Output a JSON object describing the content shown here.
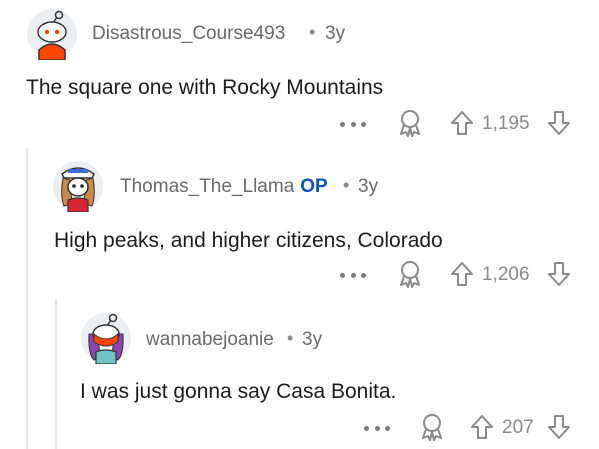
{
  "comments": [
    {
      "username": "Disastrous_Course493",
      "age": "3y",
      "separator": "•",
      "body": "The square one with Rocky Mountains",
      "score": "1,195",
      "avatar_icon": "snoo-avatar-icon"
    },
    {
      "username": "Thomas_The_Llama",
      "op_badge": "OP",
      "age": "3y",
      "separator": "•",
      "body": "High peaks, and higher citizens,  Colorado",
      "score": "1,206",
      "avatar_icon": "snoo-avatar-icon"
    },
    {
      "username": "wannabejoanie",
      "age": "3y",
      "separator": "•",
      "body": "I was just gonna say Casa Bonita.",
      "score": "207",
      "avatar_icon": "snoo-avatar-icon"
    }
  ],
  "colors": {
    "op_badge": "#0a55b8",
    "meta_text": "#6a6a6a",
    "thread_line": "#e6e6e6",
    "icon_gray": "#8a8a8a"
  }
}
